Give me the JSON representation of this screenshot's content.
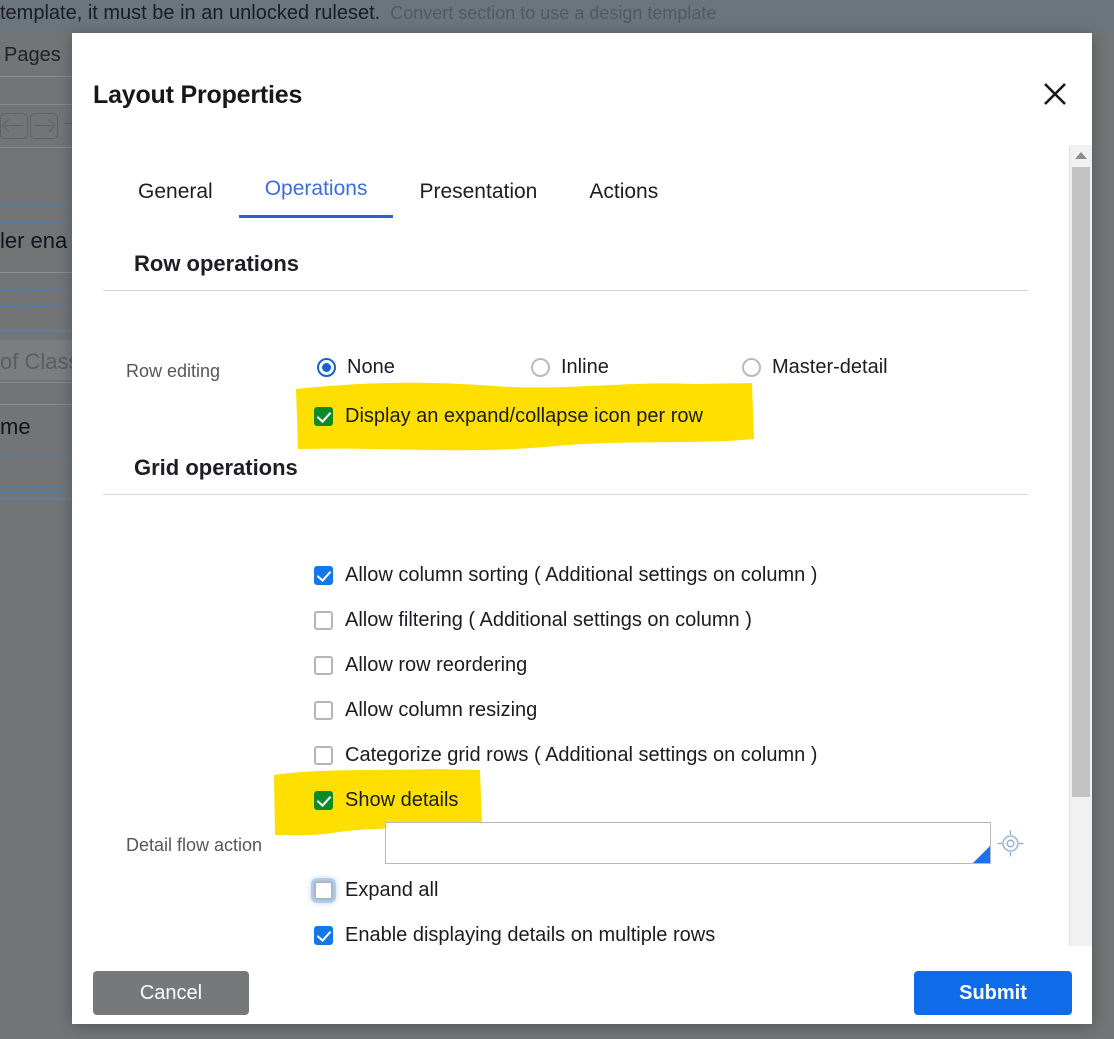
{
  "backdrop": {
    "topbar_text": "template, it must be in an unlocked ruleset.",
    "topbar_link": "Convert section to use a design template",
    "pages_label": "Pages",
    "fragments": [
      {
        "text": "ler ena",
        "muted": false
      },
      {
        "text": "of Class ",
        "muted": true
      },
      {
        "text": "me",
        "muted": false
      }
    ]
  },
  "modal": {
    "title": "Layout Properties",
    "close_icon": "close-icon",
    "tabs": [
      {
        "label": "General",
        "active": false
      },
      {
        "label": "Operations",
        "active": true
      },
      {
        "label": "Presentation",
        "active": false
      },
      {
        "label": "Actions",
        "active": false
      }
    ],
    "row_operations": {
      "heading": "Row operations",
      "row_editing_label": "Row editing",
      "radios": [
        {
          "label": "None",
          "checked": true
        },
        {
          "label": "Inline",
          "checked": false
        },
        {
          "label": "Master-detail",
          "checked": false
        }
      ],
      "expand_collapse": {
        "label": "Display an expand/collapse icon per row",
        "checked": true,
        "style": "green",
        "highlighted": true
      }
    },
    "grid_operations": {
      "heading": "Grid operations",
      "checkboxes": [
        {
          "label": "Allow column sorting ( Additional settings on column )",
          "checked": true,
          "style": "blue",
          "highlighted": false,
          "focused": false
        },
        {
          "label": "Allow filtering ( Additional settings on column )",
          "checked": false,
          "style": "blue",
          "highlighted": false,
          "focused": false
        },
        {
          "label": "Allow row reordering",
          "checked": false,
          "style": "blue",
          "highlighted": false,
          "focused": false
        },
        {
          "label": "Allow column resizing",
          "checked": false,
          "style": "blue",
          "highlighted": false,
          "focused": false
        },
        {
          "label": "Categorize grid rows ( Additional settings on column )",
          "checked": false,
          "style": "blue",
          "highlighted": false,
          "focused": false
        },
        {
          "label": "Show details",
          "checked": true,
          "style": "green",
          "highlighted": true,
          "focused": false
        },
        {
          "label": "Expand all",
          "checked": false,
          "style": "blue",
          "highlighted": false,
          "focused": true
        },
        {
          "label": "Enable displaying details on multiple rows",
          "checked": true,
          "style": "blue",
          "highlighted": false,
          "focused": false
        }
      ],
      "detail_flow_action": {
        "label": "Detail flow action",
        "value": "",
        "placeholder": "",
        "picker_icon": "target-crosshair-icon"
      }
    },
    "footer": {
      "cancel_label": "Cancel",
      "submit_label": "Submit"
    },
    "scrollbar": {
      "up_icon": "chevron-up-icon",
      "down_icon": "chevron-down-icon"
    }
  },
  "colors": {
    "accent": "#1463d2",
    "submit": "#0f6ce8",
    "cancel": "#76787a",
    "highlight": "#ffdf00",
    "green_check": "#0e8a27",
    "blue_check": "#1378e8",
    "overlay": "#727476"
  }
}
